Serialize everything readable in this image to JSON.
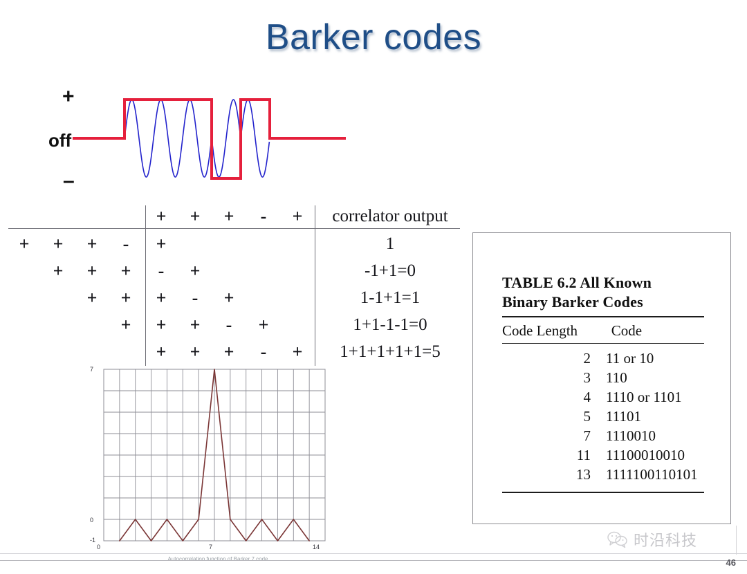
{
  "slide": {
    "title": "Barker codes",
    "page_number": "46",
    "title_color": "#1f4e87"
  },
  "waveform": {
    "label_plus": "+",
    "label_off": "off",
    "label_minus": "–",
    "envelope_color": "#e5203c",
    "carrier_color": "#2222cc",
    "chips": [
      "+",
      "+",
      "+",
      "-",
      "+"
    ]
  },
  "correlation": {
    "header_code": [
      "+",
      "+",
      "+",
      "-",
      "+"
    ],
    "output_header": "correlator output",
    "rows": [
      {
        "left": [
          "+",
          "+",
          "+",
          "-"
        ],
        "right": [
          "+",
          "",
          "",
          "",
          ""
        ],
        "output": "1"
      },
      {
        "left": [
          "",
          "+",
          "+",
          "+"
        ],
        "right": [
          "-",
          "+",
          "",
          "",
          ""
        ],
        "output": "-1+1=0"
      },
      {
        "left": [
          "",
          "",
          "+",
          "+"
        ],
        "right": [
          "+",
          "-",
          "+",
          "",
          ""
        ],
        "output": "1-1+1=1"
      },
      {
        "left": [
          "",
          "",
          "",
          "+"
        ],
        "right": [
          "+",
          "+",
          "-",
          "+",
          ""
        ],
        "output": "1+1-1-1=0"
      },
      {
        "left": [
          "",
          "",
          "",
          ""
        ],
        "right": [
          "+",
          "+",
          "+",
          "-",
          "+"
        ],
        "output": "1+1+1+1+1=5"
      }
    ]
  },
  "barker_table": {
    "caption": "TABLE 6.2   All Known Binary Barker Codes",
    "caption_line1": "TABLE 6.2   All Known",
    "caption_line2": "Binary Barker Codes",
    "columns": [
      "Code Length",
      "Code"
    ],
    "rows": [
      {
        "length": "2",
        "code": "11 or 10"
      },
      {
        "length": "3",
        "code": "110"
      },
      {
        "length": "4",
        "code": "1110 or 1101"
      },
      {
        "length": "5",
        "code": "11101"
      },
      {
        "length": "7",
        "code": "1110010"
      },
      {
        "length": "11",
        "code": "11100010010"
      },
      {
        "length": "13",
        "code": "1111100110101"
      }
    ]
  },
  "chart_data": {
    "type": "line",
    "title": "",
    "caption": "Autocorrelation function of Barker 7 code",
    "xlabel": "",
    "ylabel": "",
    "x": [
      1,
      2,
      3,
      4,
      5,
      6,
      7,
      8,
      9,
      10,
      11,
      12,
      13
    ],
    "values": [
      -1,
      0,
      -1,
      0,
      -1,
      0,
      7,
      0,
      -1,
      0,
      -1,
      0,
      -1
    ],
    "xlim": [
      0,
      14
    ],
    "ylim": [
      -1,
      7
    ],
    "xticks": [
      "0",
      "7",
      "14"
    ],
    "xtick_values": [
      0,
      7,
      14
    ],
    "yticks": [
      "7",
      "0",
      "-1"
    ],
    "ytick_values": [
      7,
      0,
      -1
    ],
    "grid": true,
    "legend": "none",
    "line_color": "#7a3535",
    "grid_color": "#8e8e96"
  },
  "watermark": {
    "text": "时沿科技",
    "icon": "chat-bubble-icon"
  }
}
